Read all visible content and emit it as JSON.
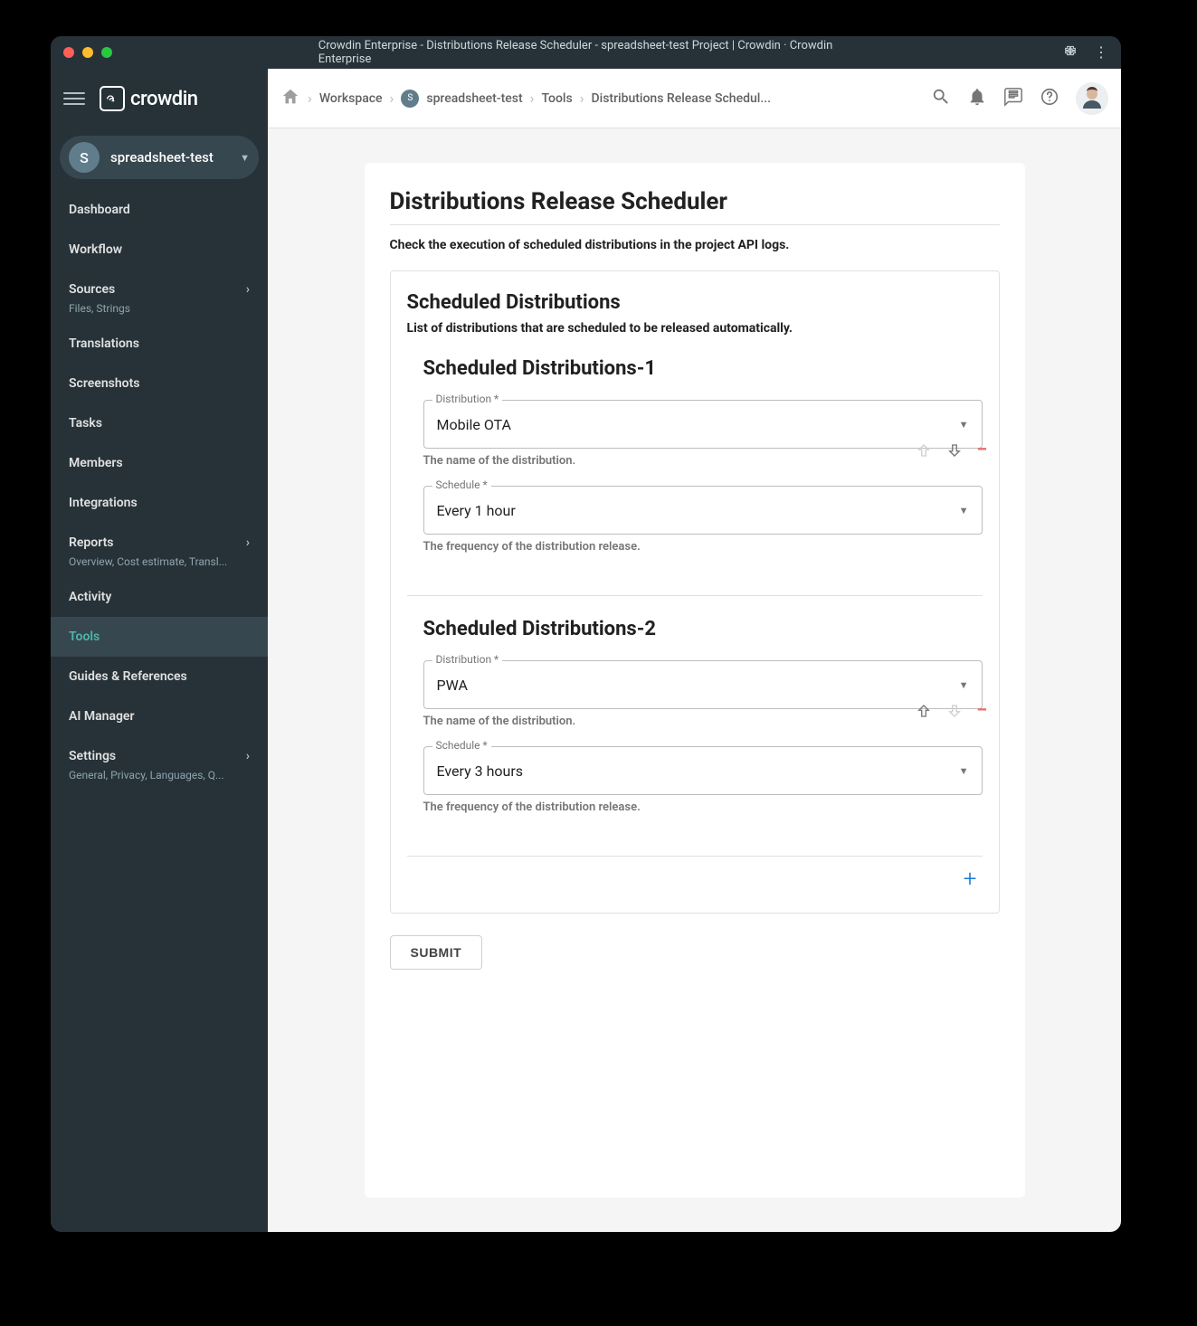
{
  "window": {
    "title": "Crowdin Enterprise - Distributions Release Scheduler - spreadsheet-test Project | Crowdin · Crowdin Enterprise"
  },
  "logo_text": "crowdin",
  "project_selector": {
    "badge": "S",
    "name": "spreadsheet-test"
  },
  "sidebar": {
    "items": [
      {
        "label": "Dashboard",
        "sub": "",
        "expandable": false,
        "active": false
      },
      {
        "label": "Workflow",
        "sub": "",
        "expandable": false,
        "active": false
      },
      {
        "label": "Sources",
        "sub": "Files, Strings",
        "expandable": true,
        "active": false
      },
      {
        "label": "Translations",
        "sub": "",
        "expandable": false,
        "active": false
      },
      {
        "label": "Screenshots",
        "sub": "",
        "expandable": false,
        "active": false
      },
      {
        "label": "Tasks",
        "sub": "",
        "expandable": false,
        "active": false
      },
      {
        "label": "Members",
        "sub": "",
        "expandable": false,
        "active": false
      },
      {
        "label": "Integrations",
        "sub": "",
        "expandable": false,
        "active": false
      },
      {
        "label": "Reports",
        "sub": "Overview, Cost estimate, Transl...",
        "expandable": true,
        "active": false
      },
      {
        "label": "Activity",
        "sub": "",
        "expandable": false,
        "active": false
      },
      {
        "label": "Tools",
        "sub": "",
        "expandable": false,
        "active": true
      },
      {
        "label": "Guides & References",
        "sub": "",
        "expandable": false,
        "active": false
      },
      {
        "label": "AI Manager",
        "sub": "",
        "expandable": false,
        "active": false
      },
      {
        "label": "Settings",
        "sub": "General, Privacy, Languages, Q...",
        "expandable": true,
        "active": false
      }
    ]
  },
  "breadcrumbs": {
    "items": [
      "Workspace",
      "spreadsheet-test",
      "Tools",
      "Distributions Release Schedul..."
    ],
    "project_badge": "S"
  },
  "page": {
    "title": "Distributions Release Scheduler",
    "description": "Check the execution of scheduled distributions in the project API logs.",
    "section_title": "Scheduled Distributions",
    "section_desc": "List of distributions that are scheduled to be released automatically.",
    "distributions": [
      {
        "heading": "Scheduled Distributions-1",
        "dist_label": "Distribution  *",
        "dist_value": "Mobile OTA",
        "dist_helper": "The name of the distribution.",
        "sched_label": "Schedule *",
        "sched_value": "Every 1 hour",
        "sched_helper": "The frequency of the distribution release.",
        "up_enabled": false,
        "down_enabled": true
      },
      {
        "heading": "Scheduled Distributions-2",
        "dist_label": "Distribution  *",
        "dist_value": "PWA",
        "dist_helper": "The name of the distribution.",
        "sched_label": "Schedule *",
        "sched_value": "Every 3 hours",
        "sched_helper": "The frequency of the distribution release.",
        "up_enabled": true,
        "down_enabled": false
      }
    ],
    "submit_label": "SUBMIT"
  }
}
